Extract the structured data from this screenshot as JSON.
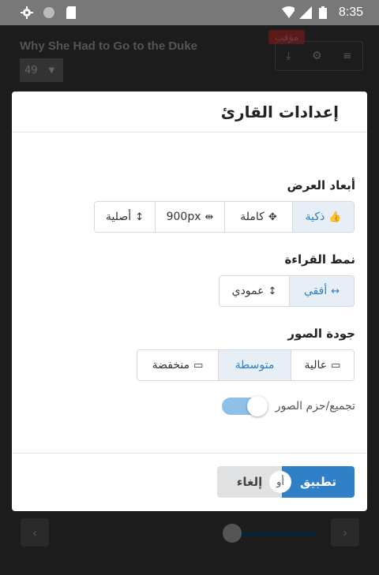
{
  "status_bar": {
    "time": "8:35",
    "left_icons": [
      "gear-icon",
      "circle-icon",
      "sd-card-icon"
    ],
    "right_icons": [
      "wifi-icon",
      "signal-icon",
      "battery-icon"
    ]
  },
  "background": {
    "title": "Why She Had to Go to the Duke",
    "chapter_select": "49",
    "paused_badge": "مؤقت",
    "toolbar_icons": [
      "download-icon",
      "gear-icon",
      "menu-icon"
    ],
    "nav_prev": "‹",
    "nav_next": "›"
  },
  "modal": {
    "title": "إعدادات القارئ",
    "display_size": {
      "label": "أبعاد العرض",
      "options": [
        {
          "label": "ذكية",
          "icon": "thumbs-up-icon",
          "glyph": "👍",
          "active": true
        },
        {
          "label": "كاملة",
          "icon": "arrows-icon",
          "glyph": "✥",
          "active": false
        },
        {
          "label": "900px",
          "icon": "text-width-icon",
          "glyph": "⇹",
          "active": false
        },
        {
          "label": "أصلية",
          "icon": "height-icon",
          "glyph": "↕",
          "active": false
        }
      ]
    },
    "reading_mode": {
      "label": "نمط القراءة",
      "options": [
        {
          "label": "أفقي",
          "icon": "horizontal-arrows-icon",
          "glyph": "↔",
          "active": true
        },
        {
          "label": "عمودي",
          "icon": "vertical-arrows-icon",
          "glyph": "↕",
          "active": false
        }
      ]
    },
    "image_quality": {
      "label": "جودة الصور",
      "options": [
        {
          "label": "عالية",
          "icon": "hdd-high-icon",
          "glyph": "▭",
          "active": false
        },
        {
          "label": "متوسطة",
          "icon": "",
          "glyph": "",
          "active": true
        },
        {
          "label": "منخفضة",
          "icon": "hdd-low-icon",
          "glyph": "▭",
          "active": false
        }
      ]
    },
    "bundle_toggle": {
      "label": "تجميع/حزم الصور",
      "enabled": true
    },
    "apply_label": "تطبيق",
    "or_label": "أو",
    "cancel_label": "إلغاء"
  }
}
